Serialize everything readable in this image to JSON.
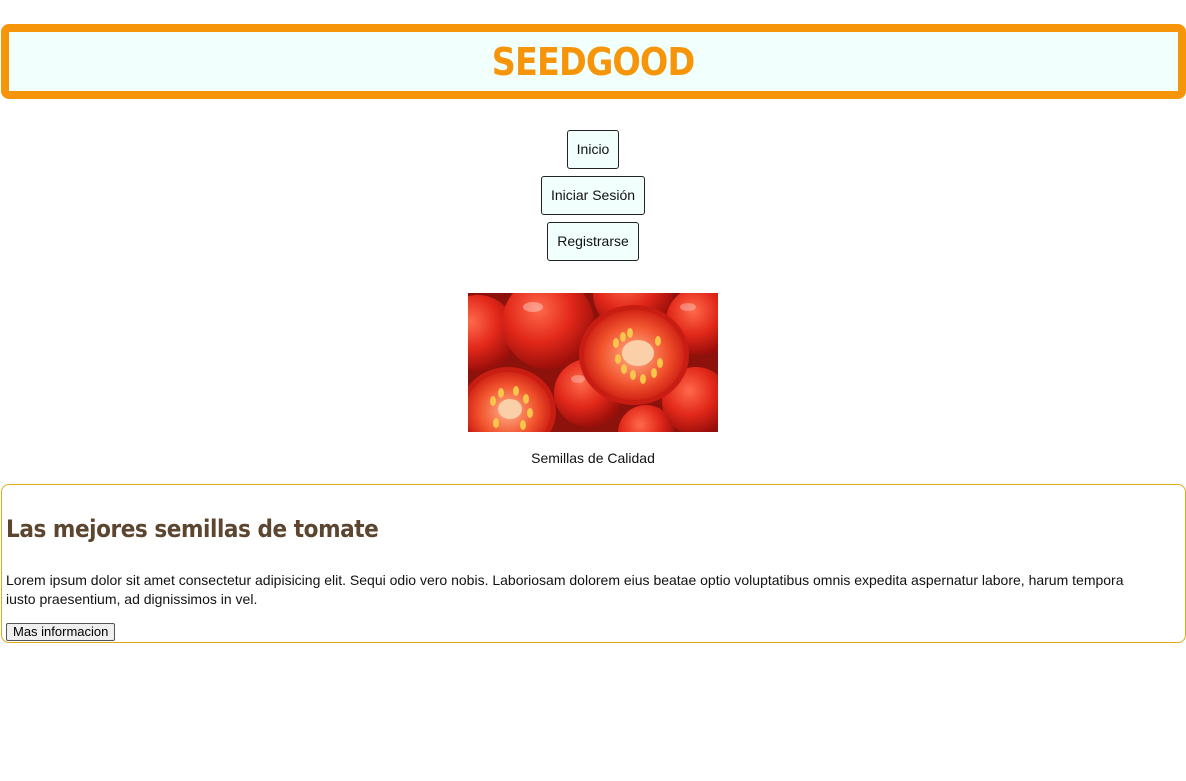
{
  "header": {
    "brand": "SEEDGOOD"
  },
  "nav": {
    "items": [
      {
        "label": "Inicio"
      },
      {
        "label": "Iniciar Sesión"
      },
      {
        "label": "Registrarse"
      }
    ]
  },
  "hero": {
    "caption": "Semillas de Calidad",
    "image": "tomatoes-photo"
  },
  "card": {
    "title": "Las mejores semillas de tomate",
    "body": "Lorem ipsum dolor sit amet consectetur adipisicing elit. Sequi odio vero nobis. Laboriosam dolorem eius beatae optio voluptatibus omnis expedita aspernatur labore, harum tempora iusto praesentium, ad dignissimos in vel.",
    "button": "Mas informacion"
  },
  "colors": {
    "accent": "#f7950a",
    "header_bg": "#f1fffd",
    "title": "#5d4630",
    "card_border": "#e0a91a"
  }
}
